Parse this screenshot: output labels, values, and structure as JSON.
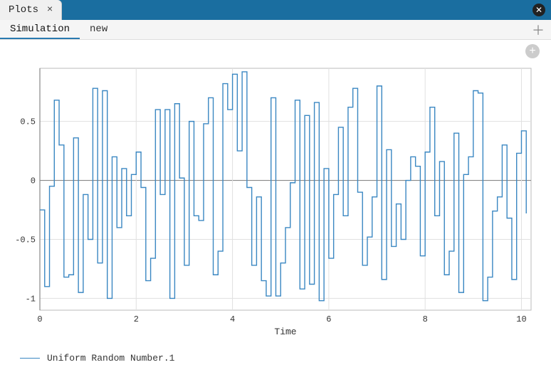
{
  "tabs": {
    "main": {
      "label": "Plots"
    }
  },
  "sub_tabs": {
    "items": [
      {
        "label": "Simulation",
        "active": true
      },
      {
        "label": "new",
        "active": false
      }
    ]
  },
  "legend": {
    "series_label": "Uniform Random Number.1"
  },
  "chart_data": {
    "type": "line",
    "title": "",
    "xlabel": "Time",
    "ylabel": "",
    "xlim": [
      0,
      10.2
    ],
    "ylim": [
      -1.1,
      0.95
    ],
    "x_ticks": [
      0,
      2,
      4,
      6,
      8,
      10
    ],
    "y_ticks": [
      -1,
      -0.5,
      0,
      0.5
    ],
    "step_interpolation": true,
    "series": [
      {
        "name": "Uniform Random Number.1",
        "color": "#3a87c2",
        "x": [
          0.0,
          0.1,
          0.2,
          0.3,
          0.4,
          0.5,
          0.6,
          0.7,
          0.8,
          0.9,
          1.0,
          1.1,
          1.2,
          1.3,
          1.4,
          1.5,
          1.6,
          1.7,
          1.8,
          1.9,
          2.0,
          2.1,
          2.2,
          2.3,
          2.4,
          2.5,
          2.6,
          2.7,
          2.8,
          2.9,
          3.0,
          3.1,
          3.2,
          3.3,
          3.4,
          3.5,
          3.6,
          3.7,
          3.8,
          3.9,
          4.0,
          4.1,
          4.2,
          4.3,
          4.4,
          4.5,
          4.6,
          4.7,
          4.8,
          4.9,
          5.0,
          5.1,
          5.2,
          5.3,
          5.4,
          5.5,
          5.6,
          5.7,
          5.8,
          5.9,
          6.0,
          6.1,
          6.2,
          6.3,
          6.4,
          6.5,
          6.6,
          6.7,
          6.8,
          6.9,
          7.0,
          7.1,
          7.2,
          7.3,
          7.4,
          7.5,
          7.6,
          7.7,
          7.8,
          7.9,
          8.0,
          8.1,
          8.2,
          8.3,
          8.4,
          8.5,
          8.6,
          8.7,
          8.8,
          8.9,
          9.0,
          9.1,
          9.2,
          9.3,
          9.4,
          9.5,
          9.6,
          9.7,
          9.8,
          9.9,
          10.0,
          10.1
        ],
        "y": [
          -0.25,
          -0.9,
          -0.05,
          0.68,
          0.3,
          -0.82,
          -0.8,
          0.36,
          -0.95,
          -0.12,
          -0.5,
          0.78,
          -0.7,
          0.76,
          -1.0,
          0.2,
          -0.4,
          0.1,
          -0.3,
          0.05,
          0.24,
          -0.06,
          -0.85,
          -0.66,
          0.6,
          -0.12,
          0.6,
          -1.0,
          0.65,
          0.02,
          -0.72,
          0.5,
          -0.3,
          -0.34,
          0.48,
          0.7,
          -0.8,
          -0.6,
          0.82,
          0.6,
          0.9,
          0.25,
          0.92,
          -0.06,
          -0.72,
          -0.14,
          -0.85,
          -0.98,
          0.7,
          -0.98,
          -0.7,
          -0.4,
          -0.02,
          0.68,
          -0.92,
          0.55,
          -0.88,
          0.66,
          -1.02,
          0.1,
          -0.66,
          -0.12,
          0.45,
          -0.3,
          0.62,
          0.78,
          -0.1,
          -0.72,
          -0.48,
          -0.14,
          0.8,
          -0.84,
          0.26,
          -0.56,
          -0.2,
          -0.5,
          0.0,
          0.2,
          0.12,
          -0.64,
          0.24,
          0.62,
          -0.3,
          0.16,
          -0.8,
          -0.6,
          0.4,
          -0.95,
          0.05,
          0.2,
          0.76,
          0.74,
          -1.02,
          -0.82,
          -0.26,
          -0.14,
          0.3,
          -0.32,
          -0.84,
          0.23,
          0.42,
          -0.28
        ]
      }
    ]
  }
}
